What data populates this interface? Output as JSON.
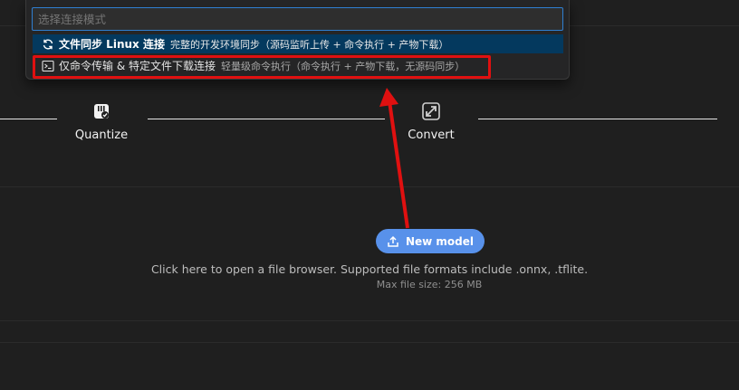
{
  "quickpick": {
    "placeholder": "选择连接模式",
    "items": [
      {
        "label": "文件同步 Linux 连接",
        "description": "完整的开发环境同步（源码监听上传 + 命令执行 + 产物下载）",
        "icon": "sync-icon",
        "selected": true
      },
      {
        "label": "仅命令传输 & 特定文件下载连接",
        "description": "轻量级命令执行（命令执行 + 产物下载，无源码同步）",
        "icon": "terminal-icon",
        "selected": false
      }
    ]
  },
  "steps": [
    {
      "label": "Quantize",
      "icon": "quantize-icon"
    },
    {
      "label": "Convert",
      "icon": "convert-icon"
    }
  ],
  "upload": {
    "button_label": "New model",
    "hint": "Click here to open a file browser. Supported file formats include .onnx, .tflite.",
    "max_size": "Max file size: 256 MB"
  },
  "colors": {
    "background": "#1f1f1f",
    "accent": "#5891ea",
    "selection": "#04395e",
    "focus_border": "#2f7fd1",
    "annotation_red": "#e01010"
  }
}
